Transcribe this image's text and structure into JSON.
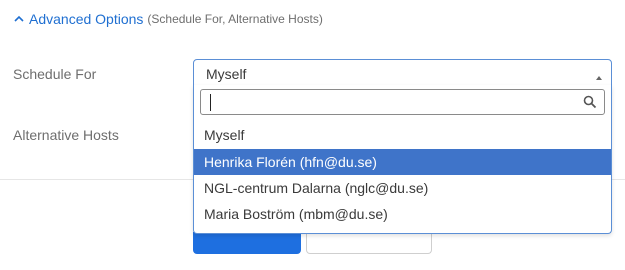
{
  "advanced": {
    "title": "Advanced Options",
    "subtitle": "(Schedule For, Alternative Hosts)"
  },
  "fields": {
    "schedule_for_label": "Schedule For",
    "alternative_hosts_label": "Alternative Hosts"
  },
  "schedule_select": {
    "selected": "Myself",
    "search_placeholder": "",
    "options": [
      {
        "label": "Myself",
        "highlighted": false
      },
      {
        "label": "Henrika Florén (hfn@du.se)",
        "highlighted": true
      },
      {
        "label": "NGL-centrum Dalarna (nglc@du.se)",
        "highlighted": false
      },
      {
        "label": "Maria Boström (mbm@du.se)",
        "highlighted": false
      }
    ]
  },
  "colors": {
    "accent": "#1f6fd1",
    "highlight": "#3f74c9",
    "primary_button": "#1e6fe0"
  },
  "icons": {
    "header": "chevron-up-icon",
    "search": "search-icon",
    "caret": "caret-up-icon"
  }
}
